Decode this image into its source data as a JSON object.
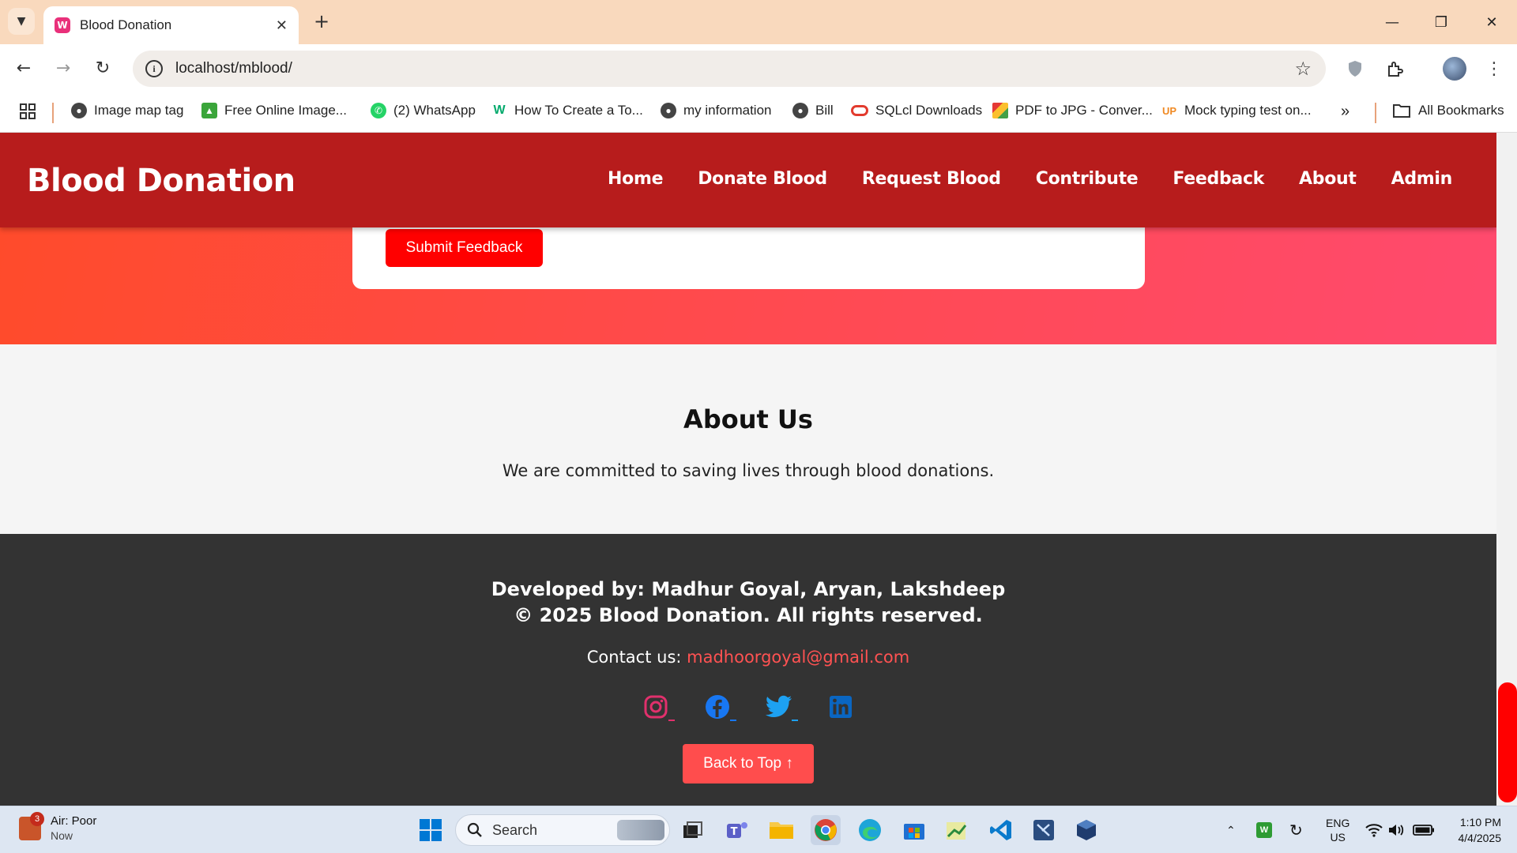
{
  "browser": {
    "tab_title": "Blood Donation",
    "url": "localhost/mblood/",
    "bookmarks": [
      {
        "label": "Image map tag",
        "icon": "globe-icon"
      },
      {
        "label": "Free Online Image...",
        "icon": "image-icon"
      },
      {
        "label": "(2) WhatsApp",
        "icon": "whatsapp-icon"
      },
      {
        "label": "How To Create a To...",
        "icon": "w3-icon"
      },
      {
        "label": "my information",
        "icon": "globe-icon"
      },
      {
        "label": "Bill",
        "icon": "globe-icon"
      },
      {
        "label": "SQLcl Downloads",
        "icon": "oracle-icon"
      },
      {
        "label": "PDF to JPG - Conver...",
        "icon": "pdf-icon"
      },
      {
        "label": "Mock typing test on...",
        "icon": "up-icon"
      }
    ],
    "more_bookmarks": "»",
    "all_bookmarks": "All Bookmarks"
  },
  "site": {
    "logo": "Blood Donation",
    "nav": [
      "Home",
      "Donate Blood",
      "Request Blood",
      "Contribute",
      "Feedback",
      "About",
      "Admin"
    ],
    "submit_label": "Submit Feedback",
    "about_title": "About Us",
    "about_text": "We are committed to saving lives through blood donations.",
    "developed_by": "Developed by: Madhur Goyal, Aryan, Lakshdeep",
    "copyright": "© 2025 Blood Donation. All rights reserved.",
    "contact_prefix": "Contact us: ",
    "contact_email": "madhoorgoyal@gmail.com",
    "socials": [
      "instagram-icon",
      "facebook-icon",
      "twitter-icon",
      "linkedin-icon"
    ],
    "back_to_top": "Back to Top ↑",
    "colors": {
      "header": "#b71c1c",
      "primary_button": "#ff0000",
      "back_to_top": "#ff4d4d",
      "footer": "#333333",
      "link": "#ff5252"
    }
  },
  "taskbar": {
    "weather_title": "Air: Poor",
    "weather_sub": "Now",
    "weather_badge": "3",
    "search_placeholder": "Search",
    "lang_top": "ENG",
    "lang_bottom": "US",
    "time": "1:10 PM",
    "date": "4/4/2025"
  }
}
